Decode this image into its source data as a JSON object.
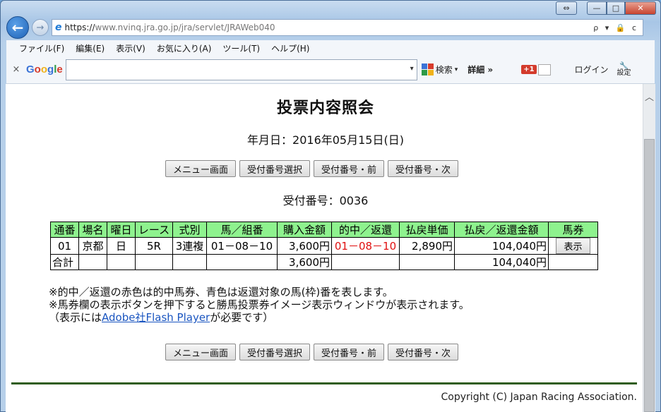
{
  "browser": {
    "address": {
      "protocol": "https://",
      "rest": "www.nvinq.jra.go.jp/jra/servlet/JRAWeb040",
      "tools": "ρ ▾ 🔒 c"
    },
    "window_controls": {
      "restore": "⇔",
      "minimize": "—",
      "maximize": "□",
      "close": "✕"
    },
    "back_glyph": "←",
    "forward_glyph": "→",
    "menu": [
      "ファイル(F)",
      "編集(E)",
      "表示(V)",
      "お気に入り(A)",
      "ツール(T)",
      "ヘルプ(H)"
    ]
  },
  "google_toolbar": {
    "close": "×",
    "logo": {
      "G": "G",
      "o1": "o",
      "o2": "o",
      "g": "g",
      "l": "l",
      "e": "e"
    },
    "search_dropdown": "▾",
    "search_button": "検索",
    "details": "詳細 »",
    "gplus": "+1",
    "login": "ログイン",
    "settings": "設定"
  },
  "page": {
    "title": "投票内容照会",
    "date": "年月日：2016年05月15日(日)",
    "buttons": [
      "メニュー画面",
      "受付番号選択",
      "受付番号・前",
      "受付番号・次"
    ],
    "receipt": "受付番号：0036",
    "table": {
      "headers": [
        "通番",
        "場名",
        "曜日",
        "レース",
        "式別",
        "馬／組番",
        "購入金額",
        "的中／返還",
        "払戻単価",
        "払戻／返還金額",
        "馬券"
      ],
      "row": {
        "seq": "01",
        "venue": "京都",
        "day": "日",
        "race": "5R",
        "type": "3連複",
        "combo": "01－08－10",
        "amount": "3,600円",
        "hit": "01－08－10",
        "unit": "2,890円",
        "payout": "104,040円",
        "show": "表示"
      },
      "total": {
        "label": "合計",
        "amount": "3,600円",
        "payout": "104,040円"
      }
    },
    "notes": {
      "line1": "※的中／返還の赤色は的中馬券、青色は返還対象の馬(枠)番を表します。",
      "line2": "※馬券欄の表示ボタンを押下すると勝馬投票券イメージ表示ウィンドウが表示されます。",
      "line3_prefix": "（表示には",
      "line3_link": "Adobe社Flash Player",
      "line3_suffix": "が必要です）"
    },
    "copyright": "Copyright (C) Japan Racing Association."
  }
}
